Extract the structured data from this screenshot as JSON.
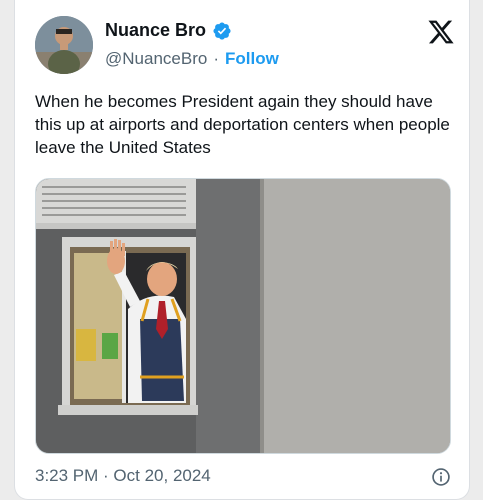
{
  "author": {
    "display_name": "Nuance Bro",
    "handle": "@NuanceBro",
    "separator": "·",
    "follow_label": "Follow",
    "verified": true
  },
  "brand_icon": "x-logo-icon",
  "tweet": {
    "text": "When he becomes President again they should have this up at airports and deportation centers when people leave the United States",
    "media_description_icon": "photo"
  },
  "footer": {
    "timestamp": "3:23 PM · Oct 20, 2024",
    "info_icon": "info-icon"
  },
  "colors": {
    "accent": "#1d9bf0",
    "text_primary": "#0f1419",
    "text_secondary": "#536471"
  }
}
